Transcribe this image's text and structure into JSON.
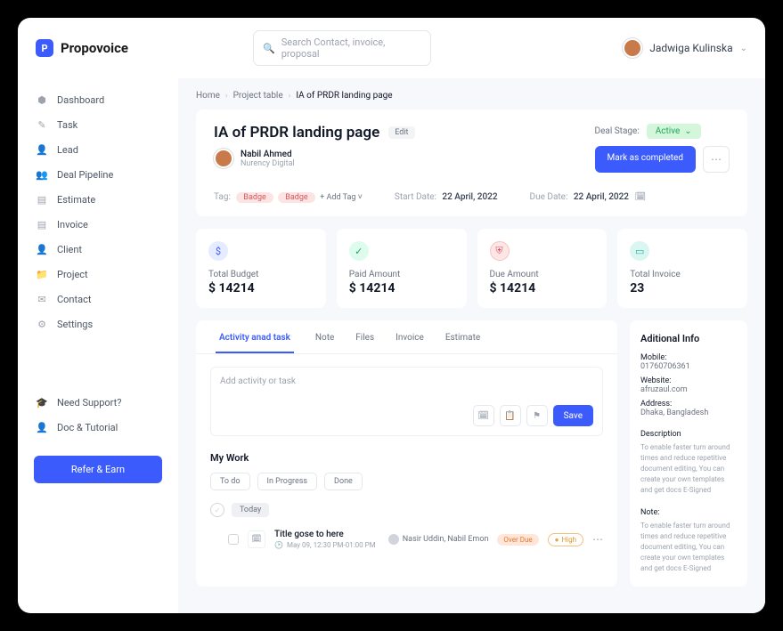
{
  "brand": "Propovoice",
  "search": {
    "placeholder": "Search Contact, invoice, proposal"
  },
  "user": {
    "name": "Jadwiga Kulinska"
  },
  "sidebar": {
    "items": [
      {
        "label": "Dashboard",
        "icon": "⬢"
      },
      {
        "label": "Task",
        "icon": "✎"
      },
      {
        "label": "Lead",
        "icon": "👤"
      },
      {
        "label": "Deal Pipeline",
        "icon": "👥"
      },
      {
        "label": "Estimate",
        "icon": "▤"
      },
      {
        "label": "Invoice",
        "icon": "▤"
      },
      {
        "label": "Client",
        "icon": "👤"
      },
      {
        "label": "Project",
        "icon": "📁"
      },
      {
        "label": "Contact",
        "icon": "✉"
      },
      {
        "label": "Settings",
        "icon": "⚙"
      }
    ],
    "footer_items": [
      {
        "label": "Need Support?",
        "icon": "🎓"
      },
      {
        "label": "Doc & Tutorial",
        "icon": "👤"
      }
    ],
    "refer_btn": "Refer & Earn"
  },
  "breadcrumbs": [
    "Home",
    "Project table",
    "IA of PRDR landing page"
  ],
  "page": {
    "title": "IA of PRDR landing page",
    "edit": "Edit",
    "owner_name": "Nabil Ahmed",
    "owner_org": "Nurency Digital",
    "deal_stage_label": "Deal Stage:",
    "deal_stage_value": "Active",
    "mark_btn": "Mark as completed",
    "tag_label": "Tag:",
    "tags": [
      "Badge",
      "Badge"
    ],
    "add_tag": "+  Add Tag  ˅",
    "start_label": "Start Date:",
    "start_val": "22 April, 2022",
    "due_label": "Due Date:",
    "due_val": "22 April, 2022"
  },
  "stats": [
    {
      "label": "Total Budget",
      "value": "$ 14214",
      "cls": "ic-blue",
      "icon": "$"
    },
    {
      "label": "Paid Amount",
      "value": "$ 14214",
      "cls": "ic-green",
      "icon": "✓"
    },
    {
      "label": "Due Amount",
      "value": "$ 14214",
      "cls": "ic-red",
      "icon": "⛨"
    },
    {
      "label": "Total Invoice",
      "value": "23",
      "cls": "ic-cyan",
      "icon": "▭"
    }
  ],
  "tabs": [
    "Activity anad task",
    "Note",
    "Files",
    "Invoice",
    "Estimate"
  ],
  "activity": {
    "placeholder": "Add activity or task",
    "save": "Save"
  },
  "mywork": {
    "title": "My Work",
    "filters": [
      "To do",
      "In Progress",
      "Done"
    ],
    "today": "Today",
    "task": {
      "title": "Title gose to here",
      "time": "May 09, 12:30 PM-01:00 PM",
      "assignees": "Nasir Uddin, Nabil Emon",
      "overdue": "Over Due",
      "priority": "High"
    }
  },
  "info": {
    "heading": "Aditional Info",
    "mobile_l": "Mobile:",
    "mobile": "01760706361",
    "web_l": "Website:",
    "web": "afruzaul.com",
    "addr_l": "Address:",
    "addr": "Dhaka, Bangladesh",
    "desc_l": "Description",
    "desc": "To enable faster turn around times and reduce repetitive document editing, You can create your own templates and get docs E-Signed",
    "note_l": "Note:",
    "note": "To enable faster turn around times and reduce repetitive document editing, You can create your own templates and get docs E-Signed"
  }
}
